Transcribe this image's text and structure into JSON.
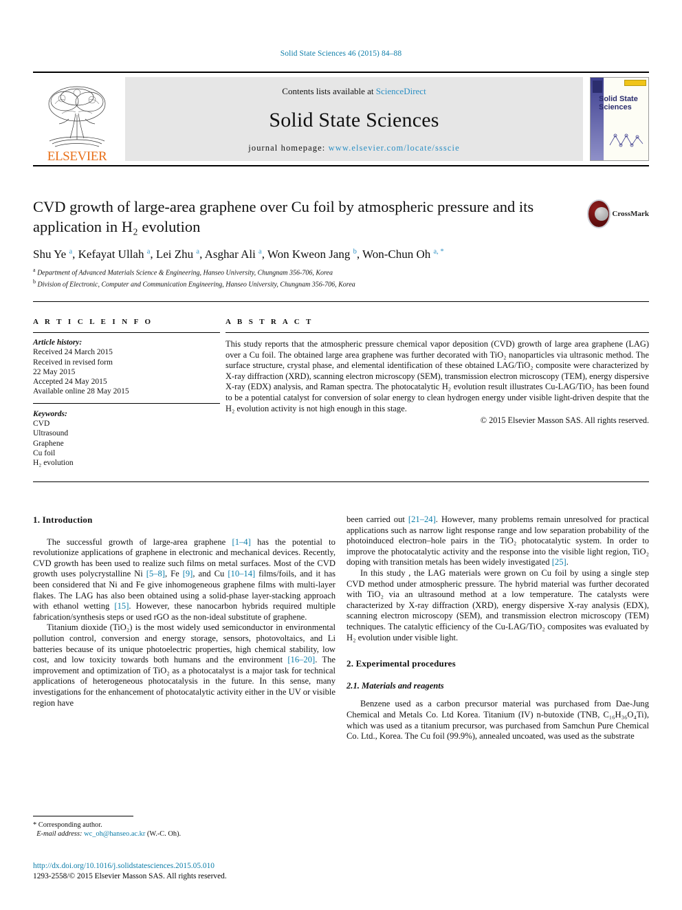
{
  "running_head": "Solid State Sciences 46 (2015) 84–88",
  "masthead": {
    "contents_prefix": "Contents lists available at ",
    "sciencedirect": "ScienceDirect",
    "journal_name": "Solid State Sciences",
    "homepage_prefix": "journal homepage: ",
    "homepage_url": "www.elsevier.com/locate/ssscie",
    "publisher": "ELSEVIER",
    "cover_title": "Solid State Sciences",
    "accent_blue": "#2b8fc4",
    "elsevier_orange": "#e8701a"
  },
  "crossmark": {
    "label": "CrossMark"
  },
  "article": {
    "title": "CVD growth of large-area graphene over Cu foil by atmospheric pressure and its application in H₂ evolution",
    "authors_html": "Shu Ye <sup>a</sup>, Kefayat Ullah <sup>a</sup>, Lei Zhu <sup>a</sup>, Asghar Ali <sup>a</sup>, Won Kweon Jang <sup>b</sup>, Won-Chun Oh <sup>a, *</sup>",
    "affiliation_a": "Department of Advanced Materials Science & Engineering, Hanseo University, Chungnam 356-706, Korea",
    "affiliation_b": "Division of Electronic, Computer and Communication Engineering, Hanseo University, Chungnam 356-706, Korea"
  },
  "info": {
    "heading": "A R T I C L E   I N F O",
    "history_label": "Article history:",
    "history": [
      "Received 24 March 2015",
      "Received in revised form",
      "22 May 2015",
      "Accepted 24 May 2015",
      "Available online 28 May 2015"
    ],
    "keywords_label": "Keywords:",
    "keywords": [
      "CVD",
      "Ultrasound",
      "Graphene",
      "Cu foil",
      "H₂ evolution"
    ]
  },
  "abstract": {
    "heading": "A B S T R A C T",
    "text": "This study reports that the atmospheric pressure chemical vapor deposition (CVD) growth of large area graphene (LAG) over a Cu foil. The obtained large area graphene was further decorated with TiO₂ nanoparticles via ultrasonic method. The surface structure, crystal phase, and elemental identification of these obtained LAG/TiO₂ composite were characterized by X-ray diffraction (XRD), scanning electron microscopy (SEM), transmission electron microscopy (TEM), energy dispersive X-ray (EDX) analysis, and Raman spectra. The photocatalytic H₂ evolution result illustrates Cu-LAG/TiO₂ has been found to be a potential catalyst for conversion of solar energy to clean hydrogen energy under visible light-driven despite that the H₂ evolution activity is not high enough in this stage.",
    "copyright": "© 2015 Elsevier Masson SAS. All rights reserved."
  },
  "sections": {
    "introduction_heading": "1. Introduction",
    "intro_p1": "The successful growth of large-area graphene [1–4] has the potential to revolutionize applications of graphene in electronic and mechanical devices. Recently, CVD growth has been used to realize such films on metal surfaces. Most of the CVD growth uses polycrystalline Ni [5–8], Fe [9], and Cu [10–14] films/foils, and it has been considered that Ni and Fe give inhomogeneous graphene films with multi-layer flakes. The LAG has also been obtained using a solid-phase layer-stacking approach with ethanol wetting [15]. However, these nanocarbon hybrids required multiple fabrication/synthesis steps or used rGO as the non-ideal substitute of graphene.",
    "intro_p2": "Titanium dioxide (TiO₂) is the most widely used semiconductor in environmental pollution control, conversion and energy storage, sensors, photovoltaics, and Li batteries because of its unique photoelectric properties, high chemical stability, low cost, and low toxicity towards both humans and the environment [16–20]. The improvement and optimization of TiO₂ as a photocatalyst is a major task for technical applications of heterogeneous photocatalysis in the future. In this sense, many investigations for the enhancement of photocatalytic activity either in the UV or visible region have",
    "intro_p3": "been carried out [21–24]. However, many problems remain unresolved for practical applications such as narrow light response range and low separation probability of the photoinduced electron–hole pairs in the TiO₂ photocatalytic system. In order to improve the photocatalytic activity and the response into the visible light region, TiO₂ doping with transition metals has been widely investigated [25].",
    "intro_p4": "In this study , the LAG materials were grown on Cu foil by using a single step CVD method under atmospheric pressure. The hybrid material was further decorated with TiO₂ via an ultrasound method at a low temperature. The catalysts were characterized by X-ray diffraction (XRD), energy dispersive X-ray analysis (EDX), scanning electron microscopy (SEM), and transmission electron microscopy (TEM) techniques. The catalytic efficiency of the Cu-LAG/TiO₂ composites was evaluated by H₂ evolution under visible light.",
    "experimental_heading": "2. Experimental procedures",
    "materials_heading": "2.1. Materials and reagents",
    "materials_p1": "Benzene used as a carbon precursor material was purchased from Dae-Jung Chemical and Metals Co. Ltd Korea. Titanium (IV) n-butoxide (TNB, C₁₆H₃₆O₄Ti), which was used as a titanium precursor, was purchased from Samchun Pure Chemical Co. Ltd., Korea. The Cu foil (99.9%), annealed uncoated, was used as the substrate"
  },
  "footnote": {
    "corresponding": "* Corresponding author.",
    "email_label": "E-mail address:",
    "email": "wc_oh@hanseo.ac.kr",
    "email_suffix": "(W.-C. Oh)."
  },
  "footer": {
    "doi": "http://dx.doi.org/10.1016/j.solidstatesciences.2015.05.010",
    "issn_line": "1293-2558/© 2015 Elsevier Masson SAS. All rights reserved."
  }
}
